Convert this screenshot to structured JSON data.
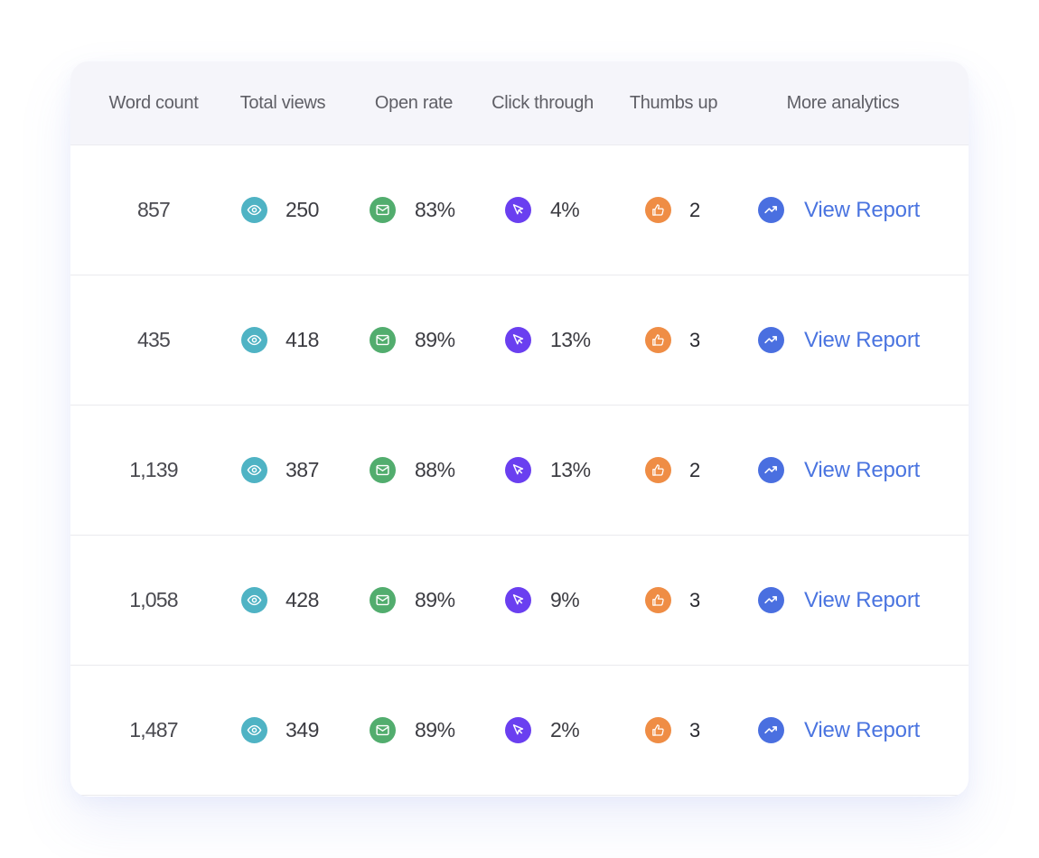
{
  "colors": {
    "views": "#4fb3c4",
    "open_rate": "#52ad6e",
    "click_through": "#6a3ff0",
    "thumbs_up": "#ef8d45",
    "analytics": "#4a6fe0",
    "link": "#4a74e0"
  },
  "header": {
    "columns": [
      "Word count",
      "Total views",
      "Open rate",
      "Click through",
      "Thumbs up",
      "More analytics"
    ]
  },
  "icons": {
    "views": "eye-icon",
    "open_rate": "mail-icon",
    "click_through": "cursor-icon",
    "thumbs_up": "thumbs-up-icon",
    "analytics": "trending-up-icon"
  },
  "rows": [
    {
      "word_count": "857",
      "total_views": "250",
      "open_rate": "83%",
      "click_through": "4%",
      "thumbs_up": "2",
      "link": "View Report"
    },
    {
      "word_count": "435",
      "total_views": "418",
      "open_rate": "89%",
      "click_through": "13%",
      "thumbs_up": "3",
      "link": "View Report"
    },
    {
      "word_count": "1,139",
      "total_views": "387",
      "open_rate": "88%",
      "click_through": "13%",
      "thumbs_up": "2",
      "link": "View Report"
    },
    {
      "word_count": "1,058",
      "total_views": "428",
      "open_rate": "89%",
      "click_through": "9%",
      "thumbs_up": "3",
      "link": "View Report"
    },
    {
      "word_count": "1,487",
      "total_views": "349",
      "open_rate": "89%",
      "click_through": "2%",
      "thumbs_up": "3",
      "link": "View Report"
    }
  ]
}
